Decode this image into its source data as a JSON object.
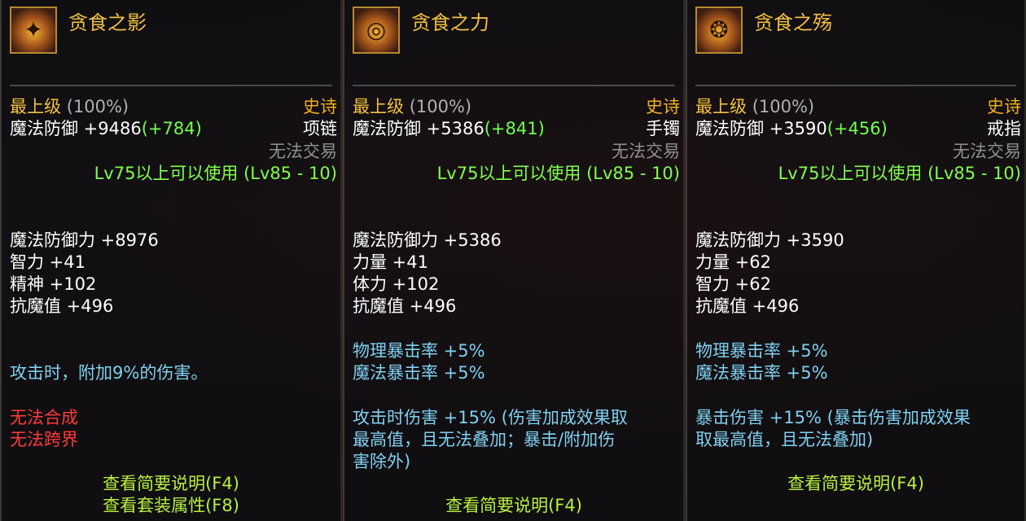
{
  "panels": [
    {
      "name": "贪食之影",
      "grade": "最上级",
      "grade_pct": "(100%)",
      "rarity": "史诗",
      "defense_label": "魔法防御 +9486",
      "defense_bonus": "(+784)",
      "slot": "项链",
      "trade": "无法交易",
      "requirement": "Lv75以上可以使用 (Lv85 - 10)",
      "stats": [
        "魔法防御力 +8976",
        "智力 +41",
        "精神 +102",
        "抗魔值 +496"
      ],
      "effect": "攻击时，附加9%的伤害。",
      "restrictions": [
        "无法合成",
        "无法跨界"
      ],
      "footer": [
        "查看简要说明(F4)",
        "查看套装属性(F8)"
      ]
    },
    {
      "name": "贪食之力",
      "grade": "最上级",
      "grade_pct": "(100%)",
      "rarity": "史诗",
      "defense_label": "魔法防御 +5386",
      "defense_bonus": "(+841)",
      "slot": "手镯",
      "trade": "无法交易",
      "requirement": "Lv75以上可以使用 (Lv85 - 10)",
      "stats": [
        "魔法防御力 +5386",
        "力量 +41",
        "体力 +102",
        "抗魔值 +496"
      ],
      "crit": [
        "物理暴击率 +5%",
        "魔法暴击率 +5%"
      ],
      "effect_lines": [
        "攻击时伤害 +15% (伤害加成效果取",
        "最高值，且无法叠加；暴击/附加伤",
        "害除外)"
      ],
      "footer": [
        "查看简要说明(F4)"
      ]
    },
    {
      "name": "贪食之殇",
      "grade": "最上级",
      "grade_pct": "(100%)",
      "rarity": "史诗",
      "defense_label": "魔法防御 +3590",
      "defense_bonus": "(+456)",
      "slot": "戒指",
      "trade": "无法交易",
      "requirement": "Lv75以上可以使用 (Lv85 - 10)",
      "stats": [
        "魔法防御力 +3590",
        "力量 +62",
        "智力 +62",
        "抗魔值 +496"
      ],
      "crit": [
        "物理暴击率 +5%",
        "魔法暴击率 +5%"
      ],
      "effect_lines": [
        "暴击伤害 +15% (暴击伤害加成效果",
        "取最高值，且无法叠加)"
      ],
      "footer": [
        "查看简要说明(F4)"
      ]
    }
  ]
}
